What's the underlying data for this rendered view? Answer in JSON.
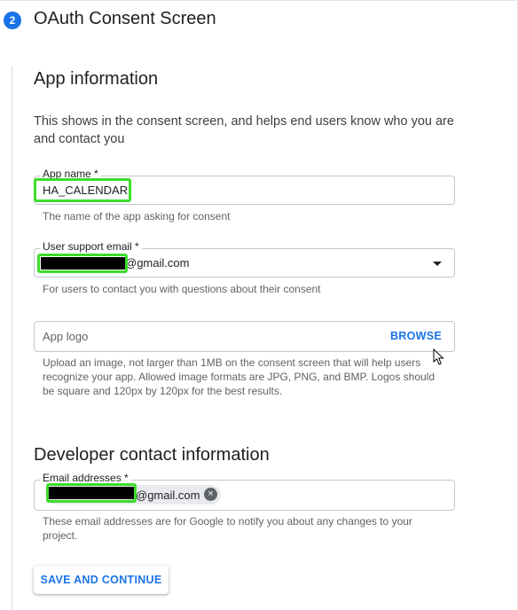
{
  "step": {
    "number": "2",
    "title": "OAuth Consent Screen"
  },
  "app_info": {
    "heading": "App information",
    "description": "This shows in the consent screen, and helps end users know who you are and contact you",
    "app_name": {
      "label": "App name *",
      "value": "HA_CALENDAR",
      "helper": "The name of the app asking for consent"
    },
    "support_email": {
      "label": "User support email *",
      "value_suffix": "@gmail.com",
      "helper": "For users to contact you with questions about their consent"
    },
    "app_logo": {
      "placeholder": "App logo",
      "browse_label": "BROWSE",
      "helper": "Upload an image, not larger than 1MB on the consent screen that will help users recognize your app. Allowed image formats are JPG, PNG, and BMP. Logos should be square and 120px by 120px for the best results."
    }
  },
  "developer_contact": {
    "heading": "Developer contact information",
    "email": {
      "label": "Email addresses *",
      "chip_suffix": "@gmail.com",
      "helper": "These email addresses are for Google to notify you about any changes to your project."
    }
  },
  "actions": {
    "save_label": "SAVE AND CONTINUE"
  },
  "colors": {
    "accent": "#1a73e8",
    "highlight": "#3cdc2a",
    "redaction": "#000000"
  },
  "icons": {
    "dropdown": "chevron-down-icon",
    "chip_remove": "close-circle-icon",
    "cursor": "mouse-pointer-icon"
  }
}
